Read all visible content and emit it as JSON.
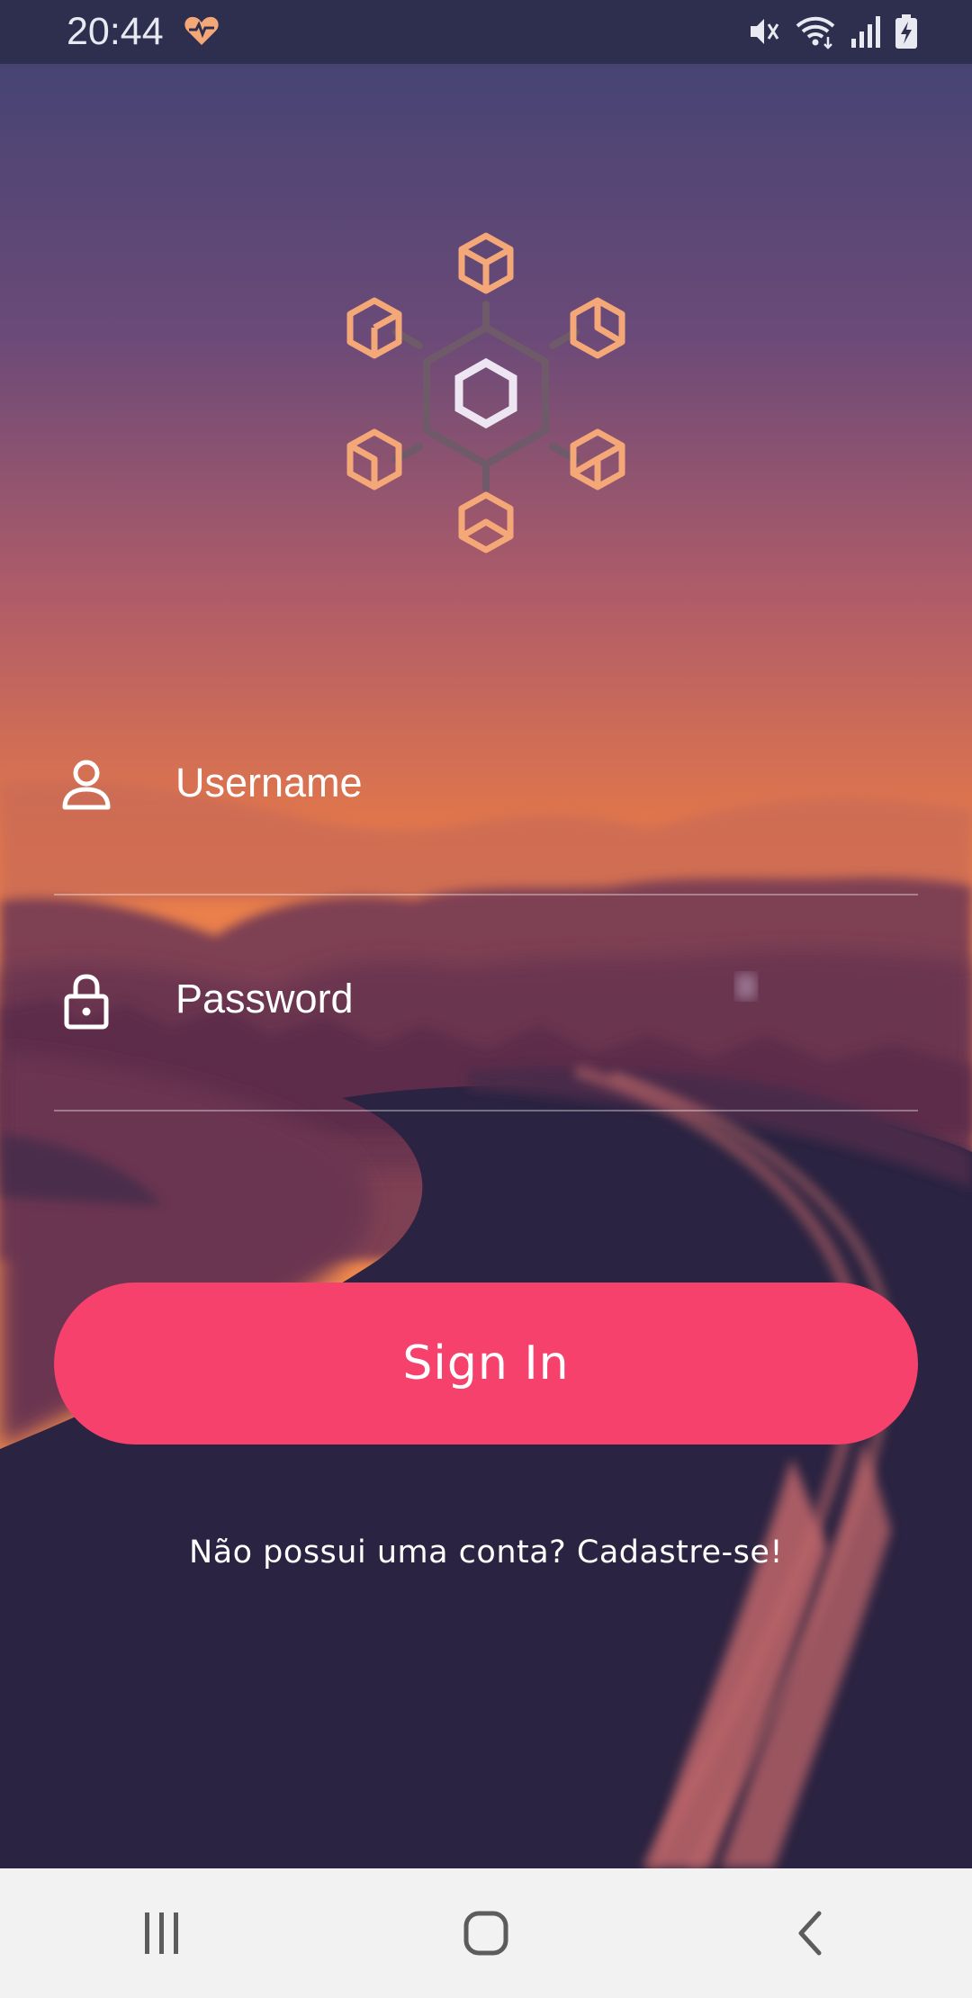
{
  "status_bar": {
    "time": "20:44",
    "icons": [
      "heart-rate-icon",
      "mute-icon",
      "wifi-icon",
      "signal-icon",
      "battery-charging-icon"
    ]
  },
  "login": {
    "username_placeholder": "Username",
    "password_placeholder": "Password",
    "sign_in_label": "Sign In",
    "signup_text": "Não possui uma conta? Cadastre-se!"
  },
  "nav_bar": {
    "buttons": [
      "recent-apps-icon",
      "home-icon",
      "back-icon"
    ]
  },
  "colors": {
    "accent": "#f5416c",
    "logo_orange": "#f4a877",
    "status_bar": "#2e2f4f",
    "nav_bar": "#f2f2f2"
  }
}
